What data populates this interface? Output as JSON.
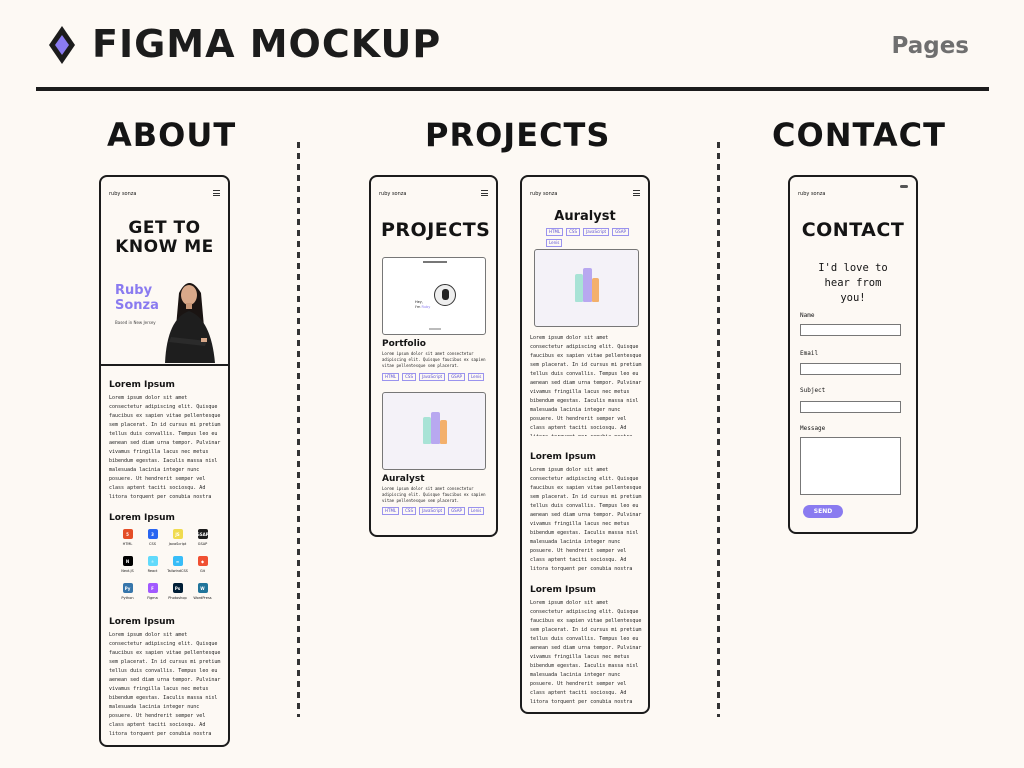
{
  "header": {
    "title": "FIGMA MOCKUP",
    "nav": "Pages",
    "logo_icon": "figma-diamond-icon"
  },
  "columns": {
    "about": "ABOUT",
    "projects": "PROJECTS",
    "contact": "CONTACT"
  },
  "phone": {
    "brand": "ruby sonza",
    "menu_icon": "hamburger-icon"
  },
  "about": {
    "hero_line1": "GET TO",
    "hero_line2": "KNOW ME",
    "name_line1": "Ruby",
    "name_line2": "Sonza",
    "based": "Based in New Jersey",
    "section1_title": "Lorem Ipsum",
    "section2_title": "Lorem Ipsum",
    "section3_title": "Lorem Ipsum",
    "lorem": "Lorem ipsum dolor sit amet consectetur adipiscing elit. Quisque faucibus ex sapien vitae pellentesque sem placerat. In id cursus mi pretium tellus duis convallis. Tempus leo eu aenean sed diam urna tempor. Pulvinar vivamus fringilla lacus nec metus bibendum egestas. Iaculis massa nisl malesuada lacinia integer nunc posuere. Ut hendrerit semper vel class aptent taciti sociosqu. Ad litora torquent per conubia nostra inceptos himenaeos.",
    "skills": [
      {
        "label": "HTML",
        "icon": "html5-icon",
        "color": "#e44d26",
        "glyph": "5"
      },
      {
        "label": "CSS",
        "icon": "css3-icon",
        "color": "#2965f1",
        "glyph": "3"
      },
      {
        "label": "JavaScript",
        "icon": "javascript-icon",
        "color": "#f0db4f",
        "glyph": "JS"
      },
      {
        "label": "GSAP",
        "icon": "gsap-icon",
        "color": "#1c1c1c",
        "glyph": "GSAP"
      },
      {
        "label": "Next.JS",
        "icon": "nextjs-icon",
        "color": "#000000",
        "glyph": "N"
      },
      {
        "label": "React",
        "icon": "react-icon",
        "color": "#61dafb",
        "glyph": "⚛"
      },
      {
        "label": "TailwindCSS",
        "icon": "tailwind-icon",
        "color": "#38bdf8",
        "glyph": "≈"
      },
      {
        "label": "Git",
        "icon": "git-icon",
        "color": "#f05032",
        "glyph": "◆"
      },
      {
        "label": "Python",
        "icon": "python-icon",
        "color": "#3776ab",
        "glyph": "Py"
      },
      {
        "label": "Figma",
        "icon": "figma-icon",
        "color": "#a259ff",
        "glyph": "F"
      },
      {
        "label": "Photoshop",
        "icon": "photoshop-icon",
        "color": "#001e36",
        "glyph": "Ps"
      },
      {
        "label": "WordPress",
        "icon": "wordpress-icon",
        "color": "#21759b",
        "glyph": "W"
      }
    ]
  },
  "projects": {
    "heading": "PROJECTS",
    "p1_title": "Portfolio",
    "p1_preview_hey": "Hey,",
    "p1_preview_im": "I'm",
    "p1_preview_name": "Ruby",
    "p2_title": "Auralyst",
    "short_lorem": "Lorem ipsum dolor sit amet consectetur adipiscing elit. Quisque faucibus ex sapien vitae pellentesque sem placerat.",
    "tags": [
      "HTML",
      "CSS",
      "JavaScript",
      "GSAP",
      "Lenis"
    ],
    "detail_title": "Auralyst",
    "detail_s1": "Lorem Ipsum",
    "detail_s2": "Lorem Ipsum",
    "lorem": "Lorem ipsum dolor sit amet consectetur adipiscing elit. Quisque faucibus ex sapien vitae pellentesque sem placerat. In id cursus mi pretium tellus duis convallis. Tempus leo eu aenean sed diam urna tempor. Pulvinar vivamus fringilla lacus nec metus bibendum egestas. Iaculis massa nisl malesuada lacinia integer nunc posuere. Ut hendrerit semper vel class aptent taciti sociosqu. Ad litora torquent per conubia nostra inceptos himenaeos."
  },
  "contact": {
    "heading": "CONTACT",
    "intro_line1": "I'd love to",
    "intro_line2": "hear from",
    "intro_line3": "you!",
    "name_label": "Name",
    "email_label": "Email",
    "subject_label": "Subject",
    "message_label": "Message",
    "send": "SEND"
  },
  "colors": {
    "accent": "#8a7bf0",
    "ink": "#1c1c1c",
    "background": "#fdf9f4"
  }
}
